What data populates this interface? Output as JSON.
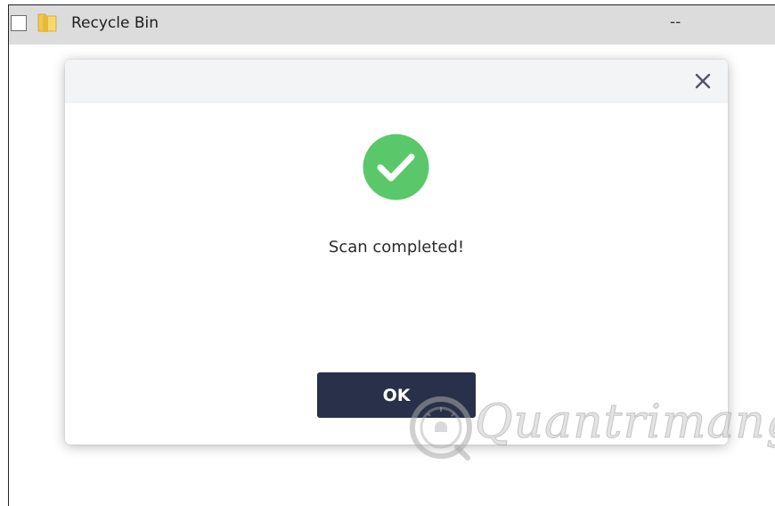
{
  "file_list": {
    "row": {
      "name": "Recycle Bin",
      "size": "--",
      "icon": "folder-icon"
    }
  },
  "dialog": {
    "close_icon": "close-icon",
    "status_icon": "check-circle-icon",
    "message": "Scan completed!",
    "ok_label": "OK"
  },
  "watermark": {
    "text": "Quantrimang"
  },
  "colors": {
    "row_background": "#dcdcdc",
    "dialog_header": "#f3f4f6",
    "success_green": "#5ac86a",
    "button_navy": "#283149"
  }
}
